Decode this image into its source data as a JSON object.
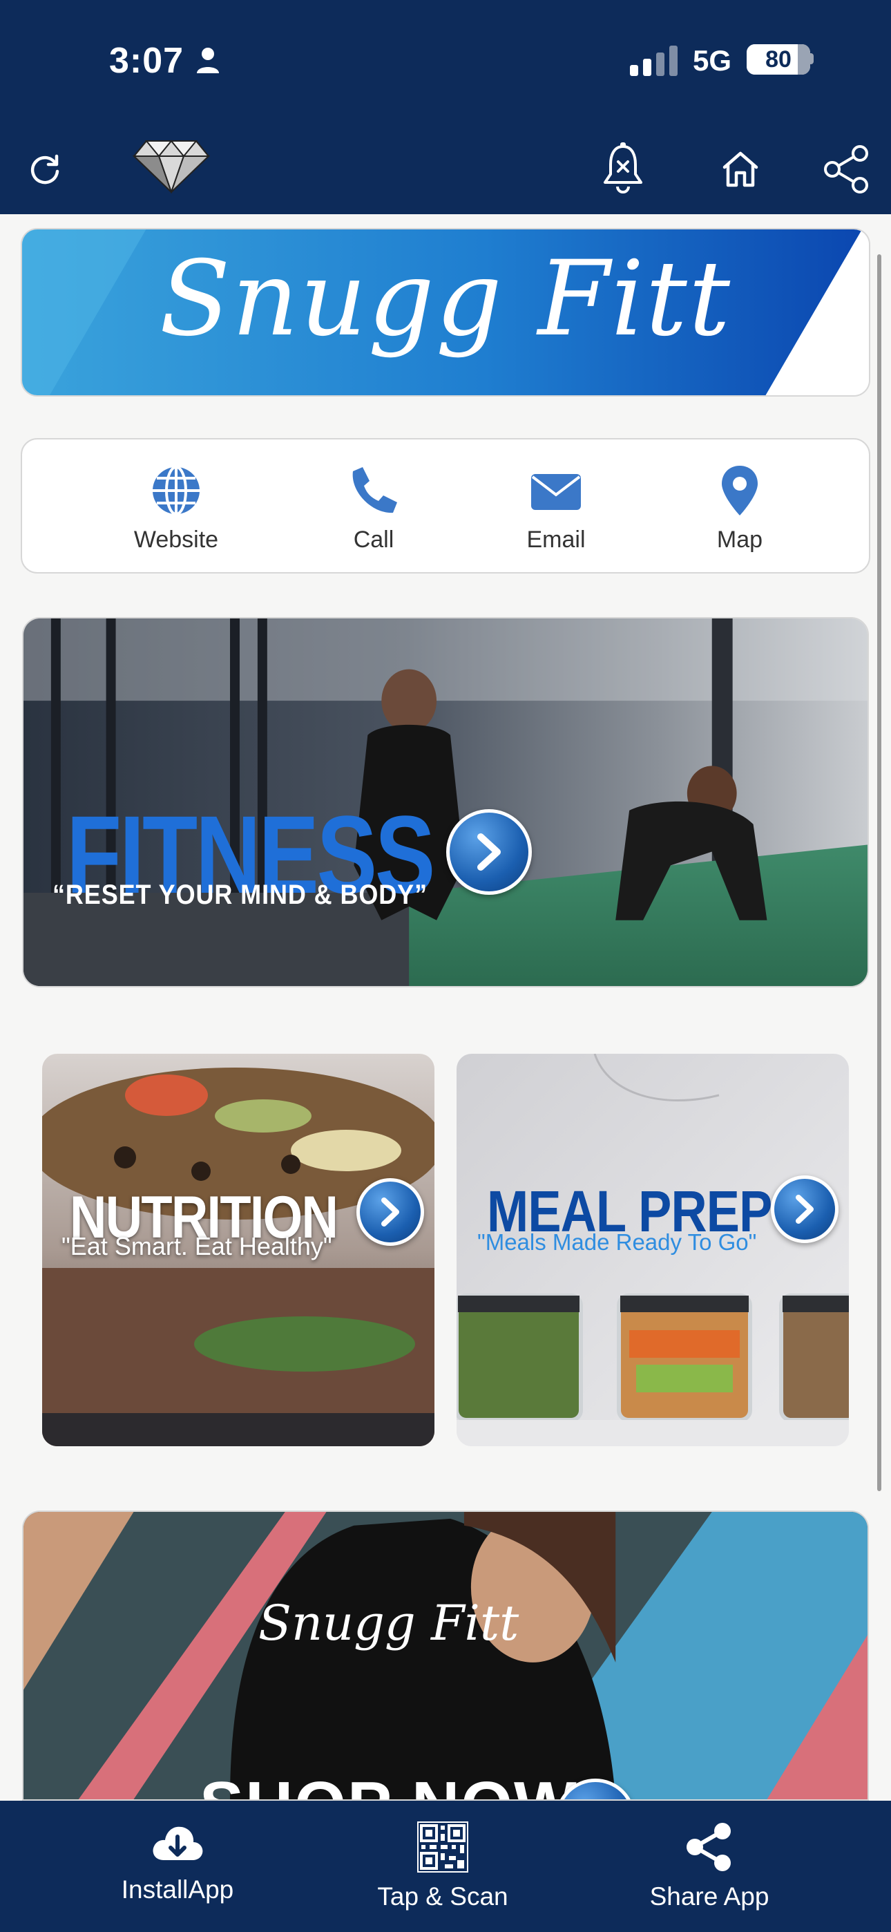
{
  "status_bar": {
    "time": "3:07",
    "network_type": "5G",
    "battery_level": "80",
    "battery_fraction": 0.8
  },
  "nav_bar": {
    "icons": [
      "refresh-icon",
      "diamond-logo",
      "bell-muted-icon",
      "home-icon",
      "share-icon"
    ]
  },
  "banner": {
    "brand_name": "Snugg Fitt",
    "colors": {
      "light_blue": "#3aa3dc",
      "dark_blue": "#0b47b0"
    }
  },
  "actions": [
    {
      "label": "Website",
      "icon": "globe-icon"
    },
    {
      "label": "Call",
      "icon": "phone-icon"
    },
    {
      "label": "Email",
      "icon": "envelope-icon"
    },
    {
      "label": "Map",
      "icon": "map-pin-icon"
    }
  ],
  "tiles": {
    "fitness": {
      "title": "FITNESS",
      "subtitle": "“RESET YOUR MIND & BODY”"
    },
    "nutrition": {
      "title": "NUTRITION",
      "subtitle": "\"Eat Smart. Eat Healthy\""
    },
    "meal_prep": {
      "title": "MEAL PREP",
      "subtitle": "\"Meals Made Ready To Go\""
    },
    "shop": {
      "brand": "Snugg Fitt",
      "title": "SHOP NOW"
    }
  },
  "bottom_bar": [
    {
      "label": "InstallApp",
      "icon": "cloud-download-icon"
    },
    {
      "label": "Tap & Scan",
      "icon": "qr-code-icon"
    },
    {
      "label": "Share App",
      "icon": "share-icon"
    }
  ],
  "colors": {
    "header_bg": "#0d2b5a",
    "accent": "#3b78c8",
    "page_bg": "#f6f6f5"
  }
}
